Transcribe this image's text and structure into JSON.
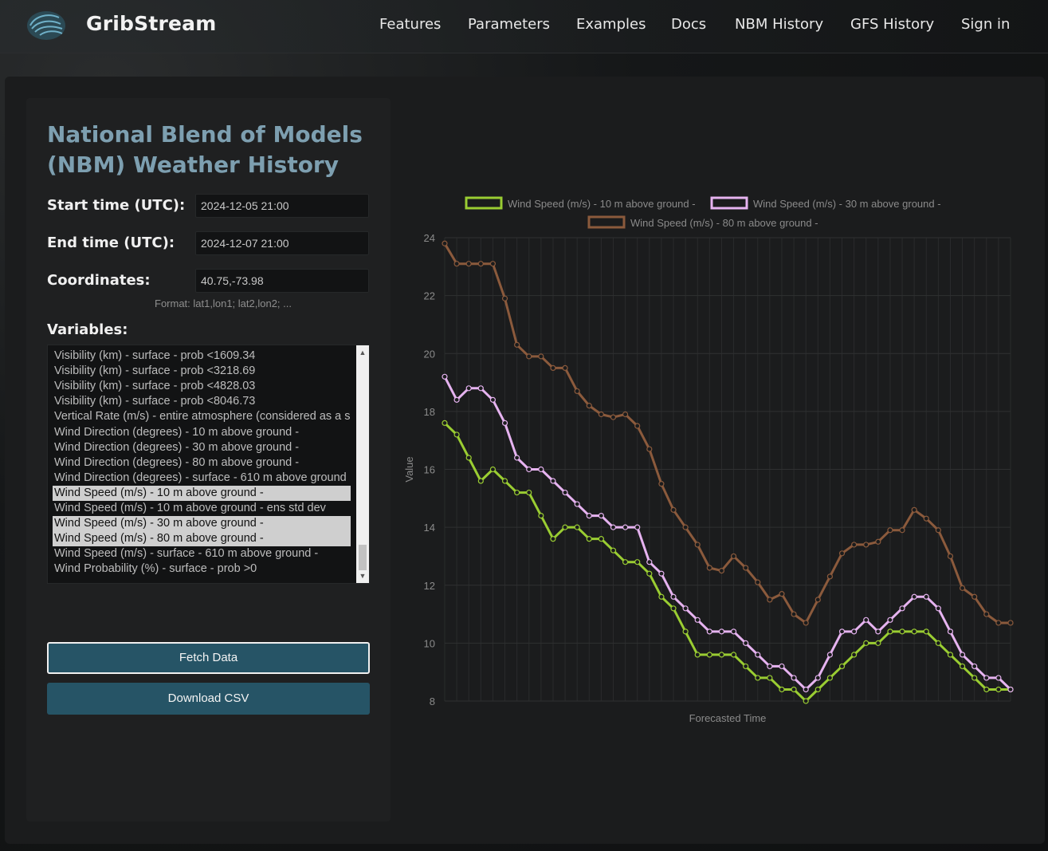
{
  "navbar": {
    "brand": "GribStream",
    "links": [
      "Features",
      "Parameters",
      "Examples",
      "Docs",
      "NBM History",
      "GFS History",
      "Sign in"
    ]
  },
  "form": {
    "title": "National Blend of Models (NBM) Weather History",
    "start_label": "Start time (UTC):",
    "start_value": "2024-12-05 21:00",
    "end_label": "End time (UTC):",
    "end_value": "2024-12-07 21:00",
    "coords_label": "Coordinates:",
    "coords_value": "40.75,-73.98",
    "coords_hint": "Format: lat1,lon1; lat2,lon2; ...",
    "variables_label": "Variables:",
    "variables": [
      {
        "label": "Visibility (km) - surface - prob <1609.34",
        "selected": false
      },
      {
        "label": "Visibility (km) - surface - prob <3218.69",
        "selected": false
      },
      {
        "label": "Visibility (km) - surface - prob <4828.03",
        "selected": false
      },
      {
        "label": "Visibility (km) - surface - prob <8046.73",
        "selected": false
      },
      {
        "label": "Vertical Rate (m/s) - entire atmosphere (considered as a s",
        "selected": false
      },
      {
        "label": "Wind Direction (degrees) - 10 m above ground -",
        "selected": false
      },
      {
        "label": "Wind Direction (degrees) - 30 m above ground -",
        "selected": false
      },
      {
        "label": "Wind Direction (degrees) - 80 m above ground -",
        "selected": false
      },
      {
        "label": "Wind Direction (degrees) - surface - 610 m above ground",
        "selected": false
      },
      {
        "label": "Wind Speed (m/s) - 10 m above ground -",
        "selected": true
      },
      {
        "label": "Wind Speed (m/s) - 10 m above ground - ens std dev",
        "selected": false
      },
      {
        "label": "Wind Speed (m/s) - 30 m above ground -",
        "selected": true
      },
      {
        "label": "Wind Speed (m/s) - 80 m above ground -",
        "selected": true
      },
      {
        "label": "Wind Speed (m/s) - surface - 610 m above ground -",
        "selected": false
      },
      {
        "label": "Wind Probability (%) - surface - prob >0",
        "selected": false
      }
    ],
    "fetch_button": "Fetch Data",
    "download_button": "Download CSV"
  },
  "chart_data": {
    "type": "line",
    "xlabel": "Forecasted Time",
    "ylabel": "Value",
    "ylim": [
      8,
      24
    ],
    "yticks": [
      8,
      10,
      12,
      14,
      16,
      18,
      20,
      22,
      24
    ],
    "grid": true,
    "legend_position": "top",
    "series": [
      {
        "name": "Wind Speed (m/s) - 10 m above ground -",
        "color": "#9acd32",
        "values": [
          17.6,
          17.2,
          16.4,
          15.6,
          16.0,
          15.6,
          15.2,
          15.2,
          14.4,
          13.6,
          14.0,
          14.0,
          13.6,
          13.6,
          13.2,
          12.8,
          12.8,
          12.4,
          11.6,
          11.2,
          10.4,
          9.6,
          9.6,
          9.6,
          9.6,
          9.2,
          8.8,
          8.8,
          8.4,
          8.4,
          8.0,
          8.4,
          8.8,
          9.2,
          9.6,
          10.0,
          10.0,
          10.4,
          10.4,
          10.4,
          10.4,
          10.0,
          9.6,
          9.2,
          8.8,
          8.4,
          8.4,
          8.4
        ]
      },
      {
        "name": "Wind Speed (m/s) - 30 m above ground -",
        "color": "#e6b3f0",
        "values": [
          19.2,
          18.4,
          18.8,
          18.8,
          18.4,
          17.6,
          16.4,
          16.0,
          16.0,
          15.6,
          15.2,
          14.8,
          14.4,
          14.4,
          14.0,
          14.0,
          14.0,
          12.8,
          12.4,
          11.6,
          11.2,
          10.8,
          10.4,
          10.4,
          10.4,
          10.0,
          9.6,
          9.2,
          9.2,
          8.8,
          8.4,
          8.8,
          9.6,
          10.4,
          10.4,
          10.8,
          10.4,
          10.8,
          11.2,
          11.6,
          11.6,
          11.2,
          10.4,
          9.6,
          9.2,
          8.8,
          8.8,
          8.4
        ]
      },
      {
        "name": "Wind Speed (m/s) - 80 m above ground -",
        "color": "#8b5a3c",
        "values": [
          23.8,
          23.1,
          23.1,
          23.1,
          23.1,
          21.9,
          20.3,
          19.9,
          19.9,
          19.5,
          19.5,
          18.7,
          18.2,
          17.9,
          17.8,
          17.9,
          17.5,
          16.7,
          15.5,
          14.6,
          14.0,
          13.4,
          12.6,
          12.5,
          13.0,
          12.6,
          12.1,
          11.5,
          11.7,
          11.0,
          10.7,
          11.5,
          12.3,
          13.1,
          13.4,
          13.4,
          13.5,
          13.9,
          13.9,
          14.6,
          14.3,
          13.9,
          13.0,
          11.9,
          11.6,
          11.0,
          10.7,
          10.7
        ]
      }
    ]
  }
}
